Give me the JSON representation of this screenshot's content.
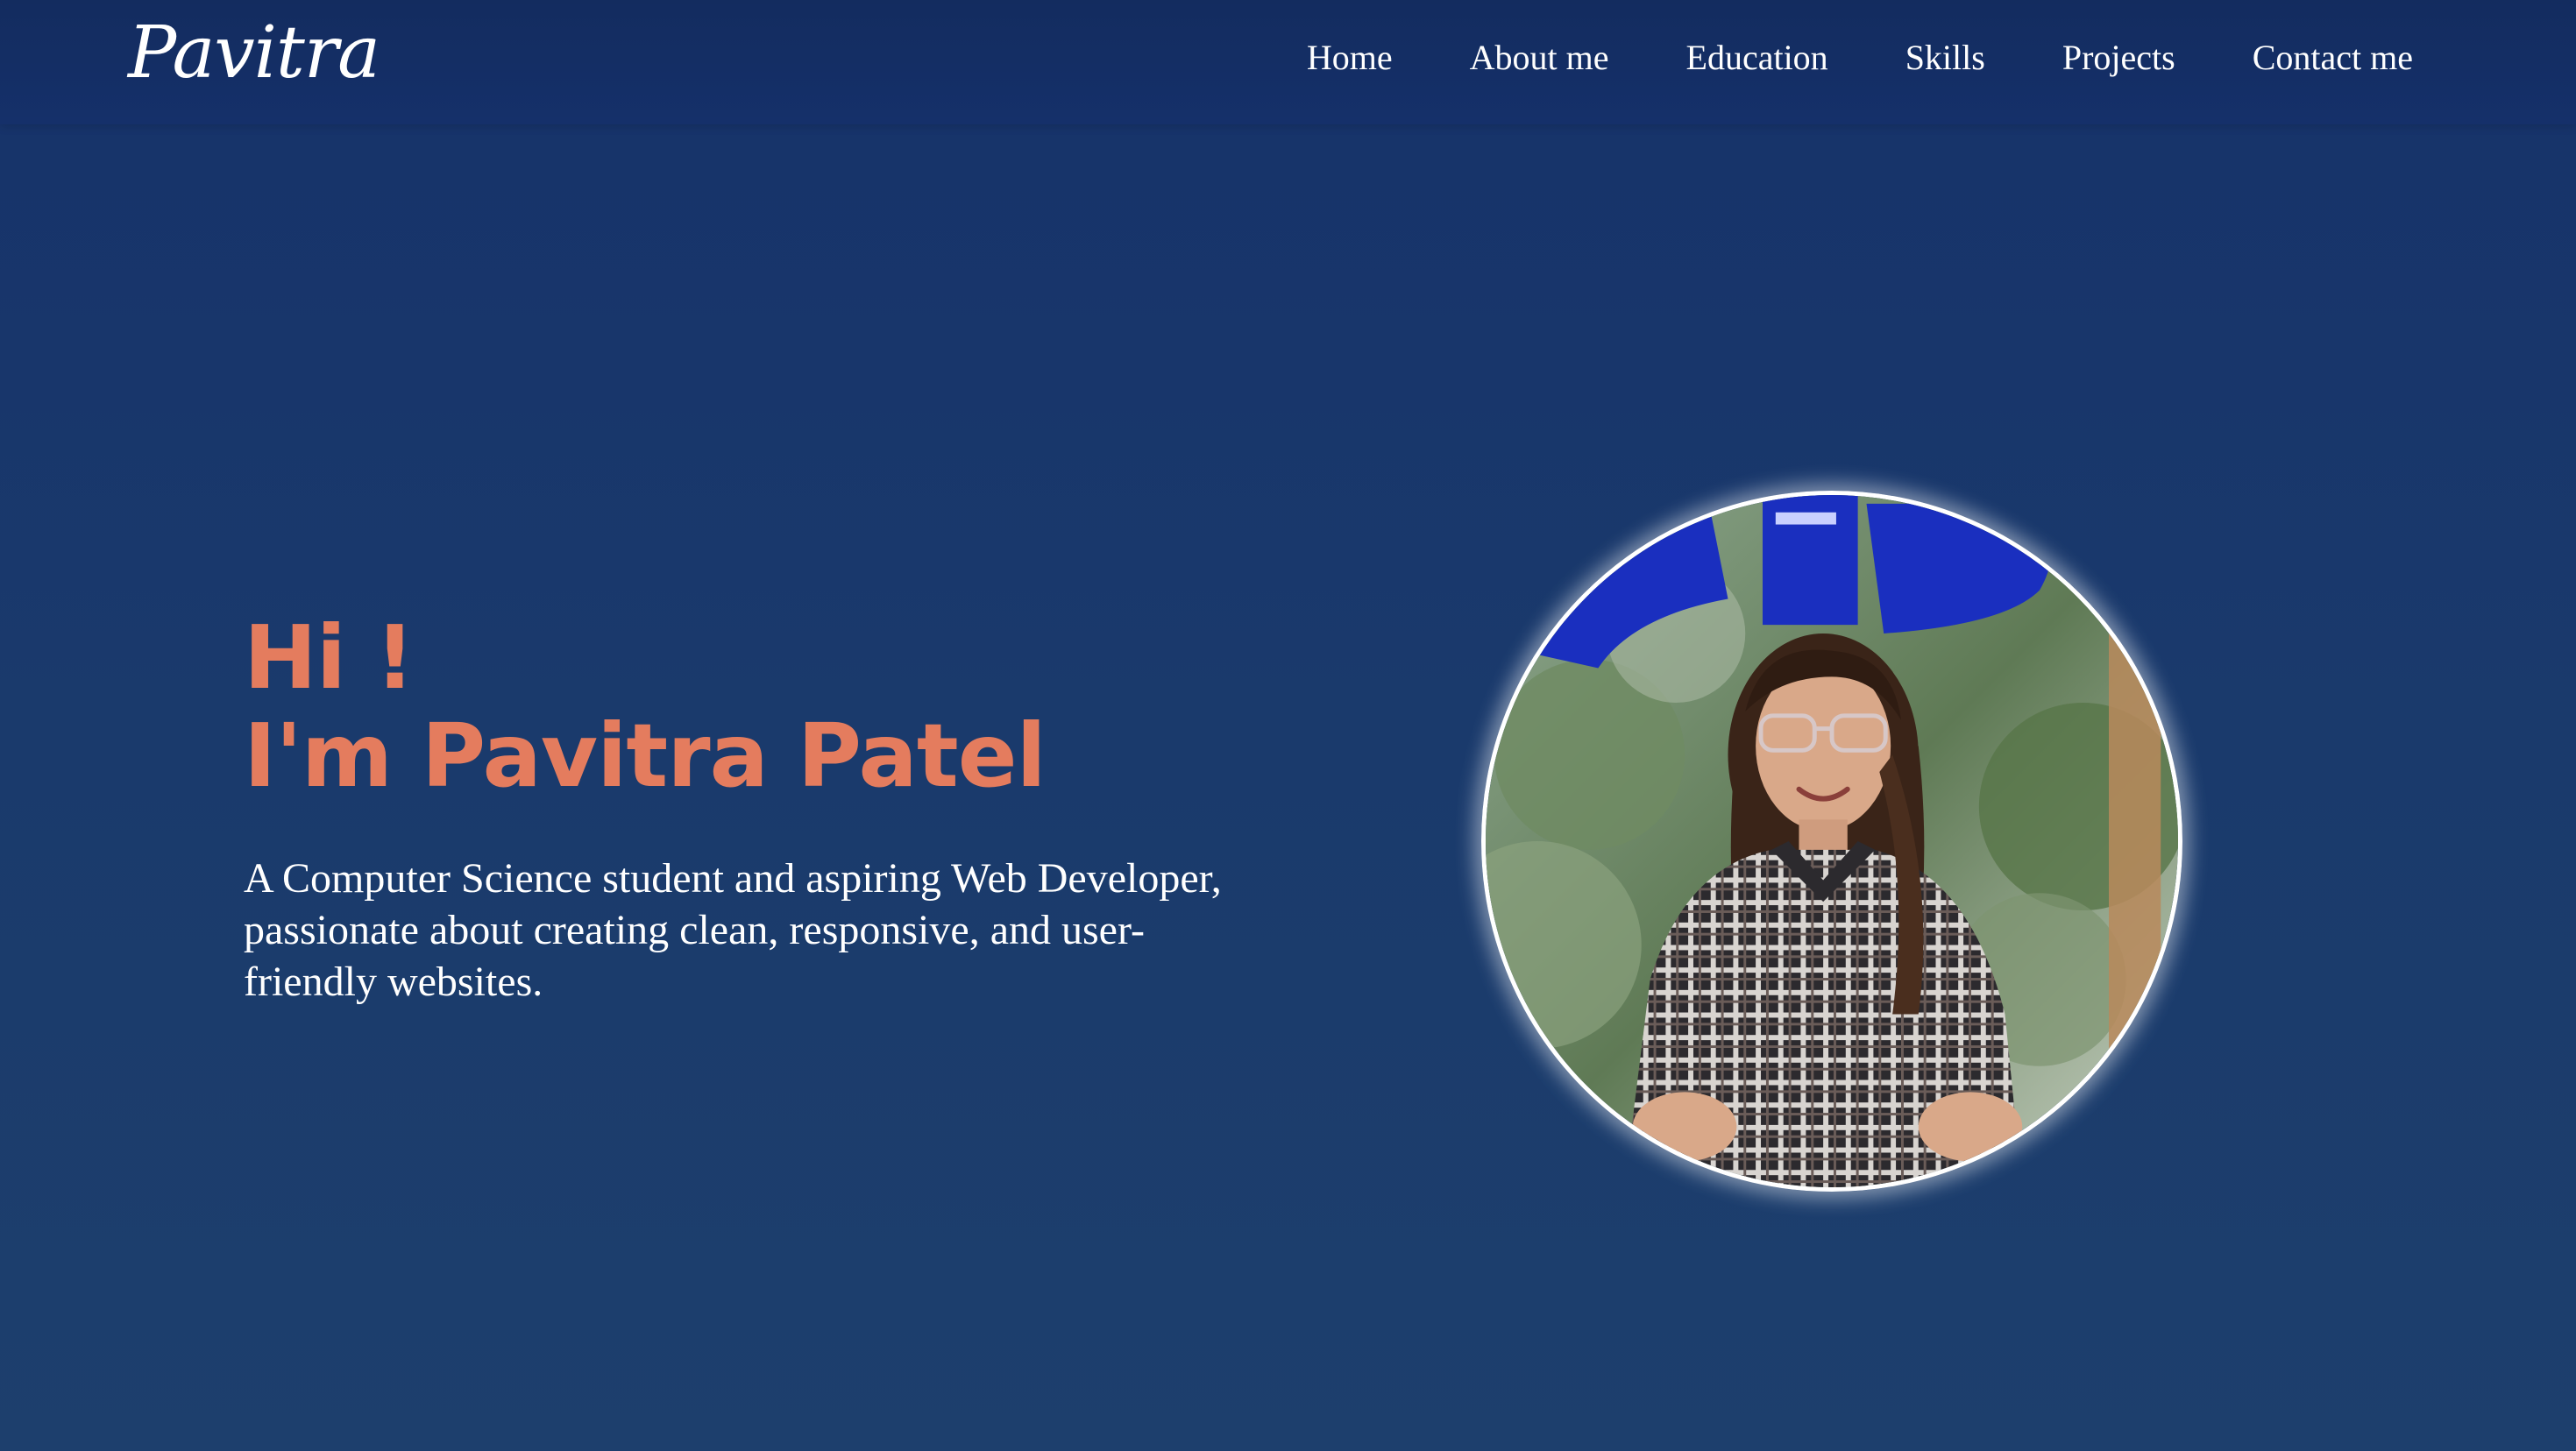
{
  "logo": {
    "text": "Pavitra"
  },
  "nav": {
    "items": [
      {
        "label": "Home"
      },
      {
        "label": "About me"
      },
      {
        "label": "Education"
      },
      {
        "label": "Skills"
      },
      {
        "label": "Projects"
      },
      {
        "label": "Contact me"
      }
    ]
  },
  "hero": {
    "greeting": "Hi !",
    "name_line": "I'm Pavitra Patel",
    "tagline": "A Computer Science student and aspiring Web Developer, passionate about creating clean, responsive, and user-friendly websites.",
    "photo_icon": "profile-photo"
  },
  "colors": {
    "background": "#1a3a6c",
    "accent": "#e47c5e",
    "text": "#ffffff"
  }
}
